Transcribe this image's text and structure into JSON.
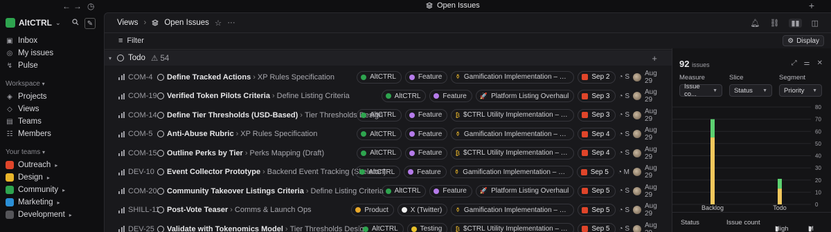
{
  "window": {
    "title": "Open Issues"
  },
  "sidebar": {
    "workspace": "AltCTRL",
    "nav": [
      {
        "label": "Inbox",
        "icon": "inbox-icon"
      },
      {
        "label": "My issues",
        "icon": "my-issues-icon"
      },
      {
        "label": "Pulse",
        "icon": "pulse-icon"
      }
    ],
    "workspace_section": "Workspace",
    "workspace_items": [
      {
        "label": "Projects",
        "icon": "projects-icon"
      },
      {
        "label": "Views",
        "icon": "views-icon"
      },
      {
        "label": "Teams",
        "icon": "teams-icon"
      },
      {
        "label": "Members",
        "icon": "members-icon"
      }
    ],
    "teams_section": "Your teams",
    "teams": [
      {
        "label": "Outreach",
        "color": "#e0452a"
      },
      {
        "label": "Design",
        "color": "#e8b52a"
      },
      {
        "label": "Community",
        "color": "#2ea44f"
      },
      {
        "label": "Marketing",
        "color": "#2b8fd6"
      },
      {
        "label": "Development",
        "color": "#555559"
      }
    ]
  },
  "header": {
    "breadcrumb_root": "Views",
    "breadcrumb_current": "Open Issues",
    "filter_label": "Filter",
    "display_label": "Display"
  },
  "group": {
    "name": "Todo",
    "count": "54"
  },
  "issues": [
    {
      "id": "COM-4",
      "title": "Define Tracked Actions",
      "parent": "XP Rules Specification",
      "team": "AltCTRL",
      "label": "Feature",
      "label_color": "#b57bea",
      "project": "Gamification Implementation – Proof of Gr...",
      "project_icon": "⚱",
      "date": "Sep 2",
      "extra": "S",
      "due": "Aug 29"
    },
    {
      "id": "COM-19",
      "title": "Verified Token Pilots Criteria",
      "parent": "Define Listing Criteria",
      "team": "AltCTRL",
      "label": "Feature",
      "label_color": "#b57bea",
      "project": "Platform Listing Overhaul",
      "project_icon": "🚀",
      "date": "Sep 3",
      "extra": "S",
      "due": "Aug 29"
    },
    {
      "id": "COM-14",
      "title": "Define Tier Thresholds (USD-Based)",
      "parent": "Tier Thresholds Design",
      "team": "AltCTRL",
      "label": "Feature",
      "label_color": "#b57bea",
      "project": "$CTRL Utility Implementation – Tiers",
      "project_icon": "₿",
      "date": "Sep 3",
      "extra": "S",
      "due": "Aug 29"
    },
    {
      "id": "COM-5",
      "title": "Anti-Abuse Rubric",
      "parent": "XP Rules Specification",
      "team": "AltCTRL",
      "label": "Feature",
      "label_color": "#b57bea",
      "project": "Gamification Implementation – Proof of Gr...",
      "project_icon": "⚱",
      "date": "Sep 4",
      "extra": "S",
      "due": "Aug 29"
    },
    {
      "id": "COM-15",
      "title": "Outline Perks by Tier",
      "parent": "Perks Mapping (Draft)",
      "team": "AltCTRL",
      "label": "Feature",
      "label_color": "#b57bea",
      "project": "$CTRL Utility Implementation – Tiers",
      "project_icon": "₿",
      "date": "Sep 4",
      "extra": "S",
      "due": "Aug 29"
    },
    {
      "id": "DEV-10",
      "title": "Event Collector Prototype",
      "parent": "Backend Event Tracking (Skeleton)",
      "team": "AltCTRL",
      "label": "Feature",
      "label_color": "#b57bea",
      "project": "Gamification Implementation – Proof of Gr...",
      "project_icon": "⚱",
      "date": "Sep 5",
      "extra": "M",
      "due": "Aug 29"
    },
    {
      "id": "COM-20",
      "title": "Community Takeover Listings Criteria",
      "parent": "Define Listing Criteria",
      "team": "AltCTRL",
      "label": "Feature",
      "label_color": "#b57bea",
      "project": "Platform Listing Overhaul",
      "project_icon": "🚀",
      "date": "Sep 5",
      "extra": "S",
      "due": "Aug 29"
    },
    {
      "id": "SHILL-11",
      "title": "Post-Vote Teaser",
      "parent": "Comms & Launch Ops",
      "team": "Product",
      "team_color": "#e8a82a",
      "label": "X (Twitter)",
      "label_color": "#f0f0f0",
      "project": "Gamification Implementation – Proof of Gr...",
      "project_icon": "⚱",
      "date": "Sep 5",
      "extra": "S",
      "due": "Aug 29"
    },
    {
      "id": "DEV-25",
      "title": "Validate with Tokenomics Model",
      "parent": "Tier Thresholds Design",
      "team": "AltCTRL",
      "label": "Testing",
      "label_color": "#e8c12a",
      "project": "$CTRL Utility Implementation – Tiers",
      "project_icon": "₿",
      "date": "Sep 5",
      "extra": "S",
      "due": "Aug 29"
    }
  ],
  "panel": {
    "count": "92",
    "count_unit": "issues",
    "measure_label": "Measure",
    "measure_value": "Issue co...",
    "slice_label": "Slice",
    "slice_value": "Status",
    "segment_label": "Segment",
    "segment_value": "Priority",
    "table_headers": [
      "Status",
      "Issue count",
      "High",
      "M"
    ]
  },
  "chart_data": {
    "type": "bar",
    "stacked": true,
    "categories": [
      "Backlog",
      "Todo"
    ],
    "series": [
      {
        "name": "High",
        "color": "#f2c75c",
        "values": [
          55,
          13
        ]
      },
      {
        "name": "Medium",
        "color": "#5cd070",
        "values": [
          15,
          8
        ]
      }
    ],
    "ylim": [
      0,
      80
    ],
    "yticks": [
      0,
      10,
      20,
      30,
      40,
      50,
      60,
      70,
      80
    ]
  }
}
